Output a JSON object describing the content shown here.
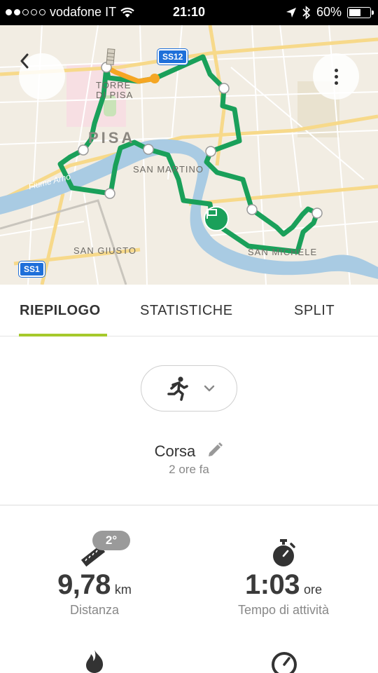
{
  "status_bar": {
    "carrier": "vodafone IT",
    "time": "21:10",
    "battery": "60%",
    "battery_level": 0.6,
    "signal_bars_filled": 2,
    "signal_bars_total": 5
  },
  "map": {
    "city_label": "PISA",
    "labels": {
      "torre_line1": "TORRE",
      "torre_line2": "DI PISA",
      "san_martino": "SAN MARTINO",
      "san_giusto": "SAN GIUSTO",
      "san_michele": "SAN MICHELE"
    },
    "river_label": "Fiume Arno",
    "road_badges": {
      "ss12": "SS12",
      "ss1": "SS1"
    },
    "colors": {
      "route": "#1aa05a",
      "route_start": "#f5a623",
      "river": "#a9cbe3",
      "map_bg": "#f2ede3"
    }
  },
  "tabs": [
    {
      "label": "RIEPILOGO",
      "active": true
    },
    {
      "label": "STATISTICHE",
      "active": false
    },
    {
      "label": "SPLIT",
      "active": false
    }
  ],
  "activity": {
    "type_icon": "running-person-icon",
    "name": "Corsa",
    "time_ago": "2 ore fa"
  },
  "stats": {
    "distance": {
      "value": "9,78",
      "unit": "km",
      "label": "Distanza",
      "icon": "ruler-icon",
      "temperature": "2°"
    },
    "duration": {
      "value": "1:03",
      "unit": "ore",
      "label": "Tempo di attività",
      "icon": "stopwatch-icon"
    }
  },
  "accent_color": "#a6c92c"
}
